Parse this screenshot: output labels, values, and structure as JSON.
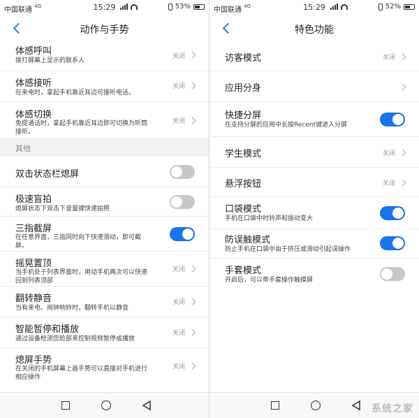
{
  "left_screen": {
    "status_bar": {
      "carrier": "中国联通",
      "network": "4G",
      "time": "15:29",
      "battery": "53%"
    },
    "title": "动作与手势",
    "top_items": [
      {
        "title": "体感呼叫",
        "subtitle": "拨打屏幕上显示的联系人",
        "status": "关闭"
      },
      {
        "title": "体感接听",
        "subtitle": "在来电时，拿起手机靠近耳边可接听电话。",
        "status": "关闭"
      },
      {
        "title": "体感切换",
        "subtitle": "免提通话时，拿起手机靠近耳边即可切换为听筒",
        "subtitle2": "接听。",
        "status": "关闭"
      }
    ],
    "section_header": "其他",
    "other_items": [
      {
        "title": "双击状态栏熄屏",
        "toggle": "off"
      },
      {
        "title": "极速盲拍",
        "subtitle": "熄屏状态下双击下音量键快速拍照",
        "toggle": "off"
      },
      {
        "title": "三指截屏",
        "subtitle": "在任意界面，三指同时向下快速滑动，即可截",
        "subtitle2": "屏。",
        "toggle": "on"
      },
      {
        "title": "摇晃置顶",
        "subtitle": "当手机处于列表界面时，用动手机两次可以快速",
        "subtitle2": "回到列表顶部",
        "status": "关闭"
      },
      {
        "title": "翻转静音",
        "subtitle": "当有来电、闹钟响铃时，翻转手机以静音",
        "status": "关闭"
      },
      {
        "title": "智能暂停和播放",
        "subtitle": "通过设备检测您脸部来控制视频暂停或播放",
        "status": "关闭"
      },
      {
        "title": "熄屏手势",
        "subtitle": "在关闭的手机屏幕上画手势可以直接对手机进行",
        "subtitle2": "相应操作",
        "status": "关闭"
      }
    ]
  },
  "right_screen": {
    "status_bar": {
      "carrier": "中国联通",
      "network": "4G",
      "time": "15:29",
      "battery": "52%"
    },
    "title": "特色功能",
    "items": [
      {
        "title": "访客模式",
        "status": "关闭"
      },
      {
        "title": "应用分身"
      },
      {
        "title": "快捷分屏",
        "subtitle": "在支持分屏的应用中长按Recent键进入分屏",
        "toggle": "on"
      },
      {
        "title": "学生模式",
        "status": "关闭"
      },
      {
        "title": "悬浮按钮",
        "status": "关闭"
      },
      {
        "title": "口袋模式",
        "subtitle": "手机在口袋中时铃声和振动变大",
        "toggle": "on"
      },
      {
        "title": "防误触模式",
        "subtitle": "防止手机在口袋中由于挤压或滑动引起误操作",
        "toggle": "on"
      },
      {
        "title": "手套模式",
        "subtitle": "开启后，可以带手套操作触摸屏",
        "toggle": "off"
      }
    ]
  },
  "watermark": "系统之家",
  "colors": {
    "accent": "#1a73e8",
    "toggle_off": "#c8c8c8",
    "back_arrow": "#2a7ee0"
  }
}
